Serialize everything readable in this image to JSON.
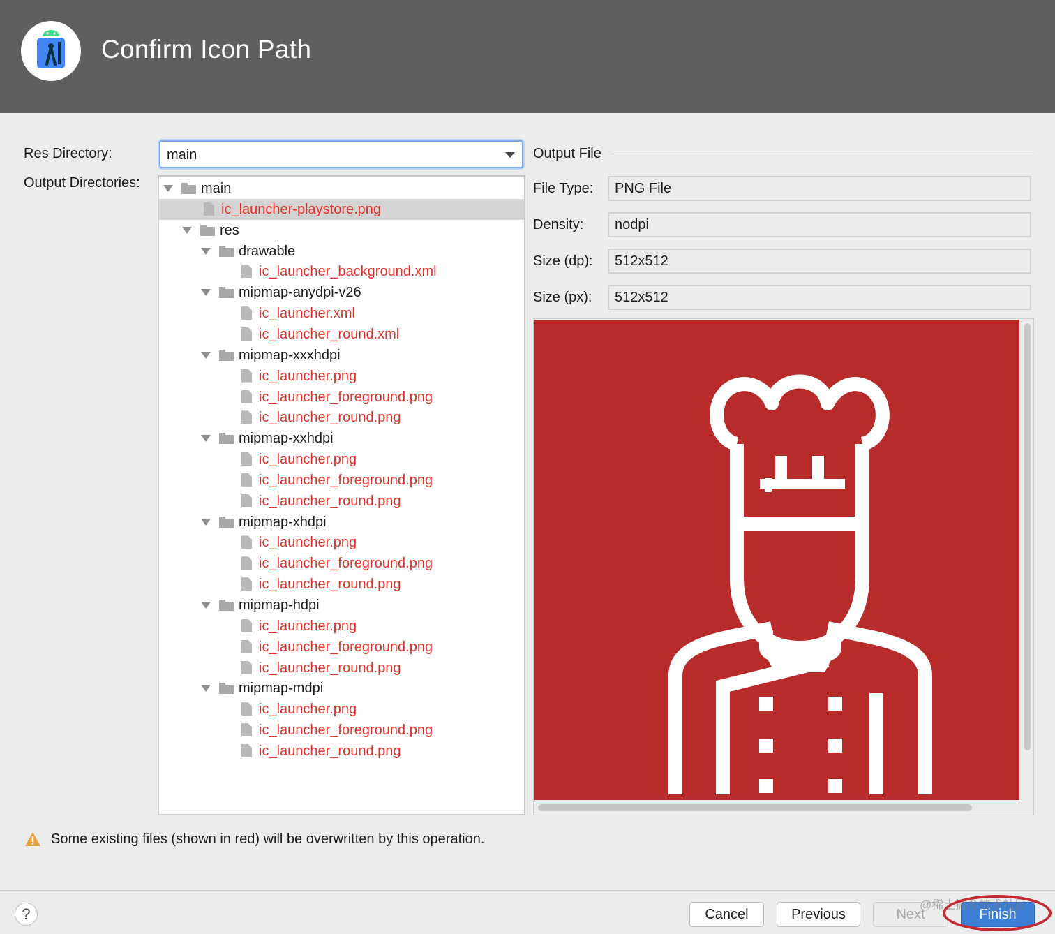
{
  "header": {
    "title": "Confirm Icon Path",
    "logo_icon": "android-studio-icon"
  },
  "labels": {
    "res_directory": "Res Directory:",
    "output_directories": "Output Directories:",
    "output_file": "Output File",
    "file_type": "File Type:",
    "density": "Density:",
    "size_dp": "Size (dp):",
    "size_px": "Size (px):"
  },
  "res_directory": {
    "value": "main"
  },
  "output_file": {
    "file_type": "PNG File",
    "density": "nodpi",
    "size_dp": "512x512",
    "size_px": "512x512",
    "preview_icon": "chef-icon",
    "preview_background": "#b72b2a"
  },
  "tree": [
    {
      "kind": "folder",
      "name": "main",
      "depth": 0,
      "expanded": true
    },
    {
      "kind": "file",
      "name": "ic_launcher-playstore.png",
      "depth": 1,
      "overwrite": true,
      "selected": true
    },
    {
      "kind": "folder",
      "name": "res",
      "depth": 1,
      "expanded": true
    },
    {
      "kind": "folder",
      "name": "drawable",
      "depth": 2,
      "expanded": true
    },
    {
      "kind": "file",
      "name": "ic_launcher_background.xml",
      "depth": 3,
      "overwrite": true
    },
    {
      "kind": "folder",
      "name": "mipmap-anydpi-v26",
      "depth": 2,
      "expanded": true
    },
    {
      "kind": "file",
      "name": "ic_launcher.xml",
      "depth": 3,
      "overwrite": true
    },
    {
      "kind": "file",
      "name": "ic_launcher_round.xml",
      "depth": 3,
      "overwrite": true
    },
    {
      "kind": "folder",
      "name": "mipmap-xxxhdpi",
      "depth": 2,
      "expanded": true
    },
    {
      "kind": "file",
      "name": "ic_launcher.png",
      "depth": 3,
      "overwrite": true
    },
    {
      "kind": "file",
      "name": "ic_launcher_foreground.png",
      "depth": 3,
      "overwrite": true
    },
    {
      "kind": "file",
      "name": "ic_launcher_round.png",
      "depth": 3,
      "overwrite": true
    },
    {
      "kind": "folder",
      "name": "mipmap-xxhdpi",
      "depth": 2,
      "expanded": true
    },
    {
      "kind": "file",
      "name": "ic_launcher.png",
      "depth": 3,
      "overwrite": true
    },
    {
      "kind": "file",
      "name": "ic_launcher_foreground.png",
      "depth": 3,
      "overwrite": true
    },
    {
      "kind": "file",
      "name": "ic_launcher_round.png",
      "depth": 3,
      "overwrite": true
    },
    {
      "kind": "folder",
      "name": "mipmap-xhdpi",
      "depth": 2,
      "expanded": true
    },
    {
      "kind": "file",
      "name": "ic_launcher.png",
      "depth": 3,
      "overwrite": true
    },
    {
      "kind": "file",
      "name": "ic_launcher_foreground.png",
      "depth": 3,
      "overwrite": true
    },
    {
      "kind": "file",
      "name": "ic_launcher_round.png",
      "depth": 3,
      "overwrite": true
    },
    {
      "kind": "folder",
      "name": "mipmap-hdpi",
      "depth": 2,
      "expanded": true
    },
    {
      "kind": "file",
      "name": "ic_launcher.png",
      "depth": 3,
      "overwrite": true
    },
    {
      "kind": "file",
      "name": "ic_launcher_foreground.png",
      "depth": 3,
      "overwrite": true
    },
    {
      "kind": "file",
      "name": "ic_launcher_round.png",
      "depth": 3,
      "overwrite": true
    },
    {
      "kind": "folder",
      "name": "mipmap-mdpi",
      "depth": 2,
      "expanded": true
    },
    {
      "kind": "file",
      "name": "ic_launcher.png",
      "depth": 3,
      "overwrite": true
    },
    {
      "kind": "file",
      "name": "ic_launcher_foreground.png",
      "depth": 3,
      "overwrite": true
    },
    {
      "kind": "file",
      "name": "ic_launcher_round.png",
      "depth": 3,
      "overwrite": true
    }
  ],
  "warning": {
    "icon": "warning-icon",
    "text": "Some existing files (shown in red) will be overwritten by this operation."
  },
  "footer": {
    "help_label": "?",
    "cancel": "Cancel",
    "previous": "Previous",
    "next": "Next",
    "finish": "Finish",
    "watermark": "@稀土掘金技术社区"
  },
  "colors": {
    "header_bg": "#5f5f5f",
    "overwrite_text": "#e0322a",
    "primary_button": "#3d7ed6",
    "highlight_ring": "#c22b32"
  }
}
